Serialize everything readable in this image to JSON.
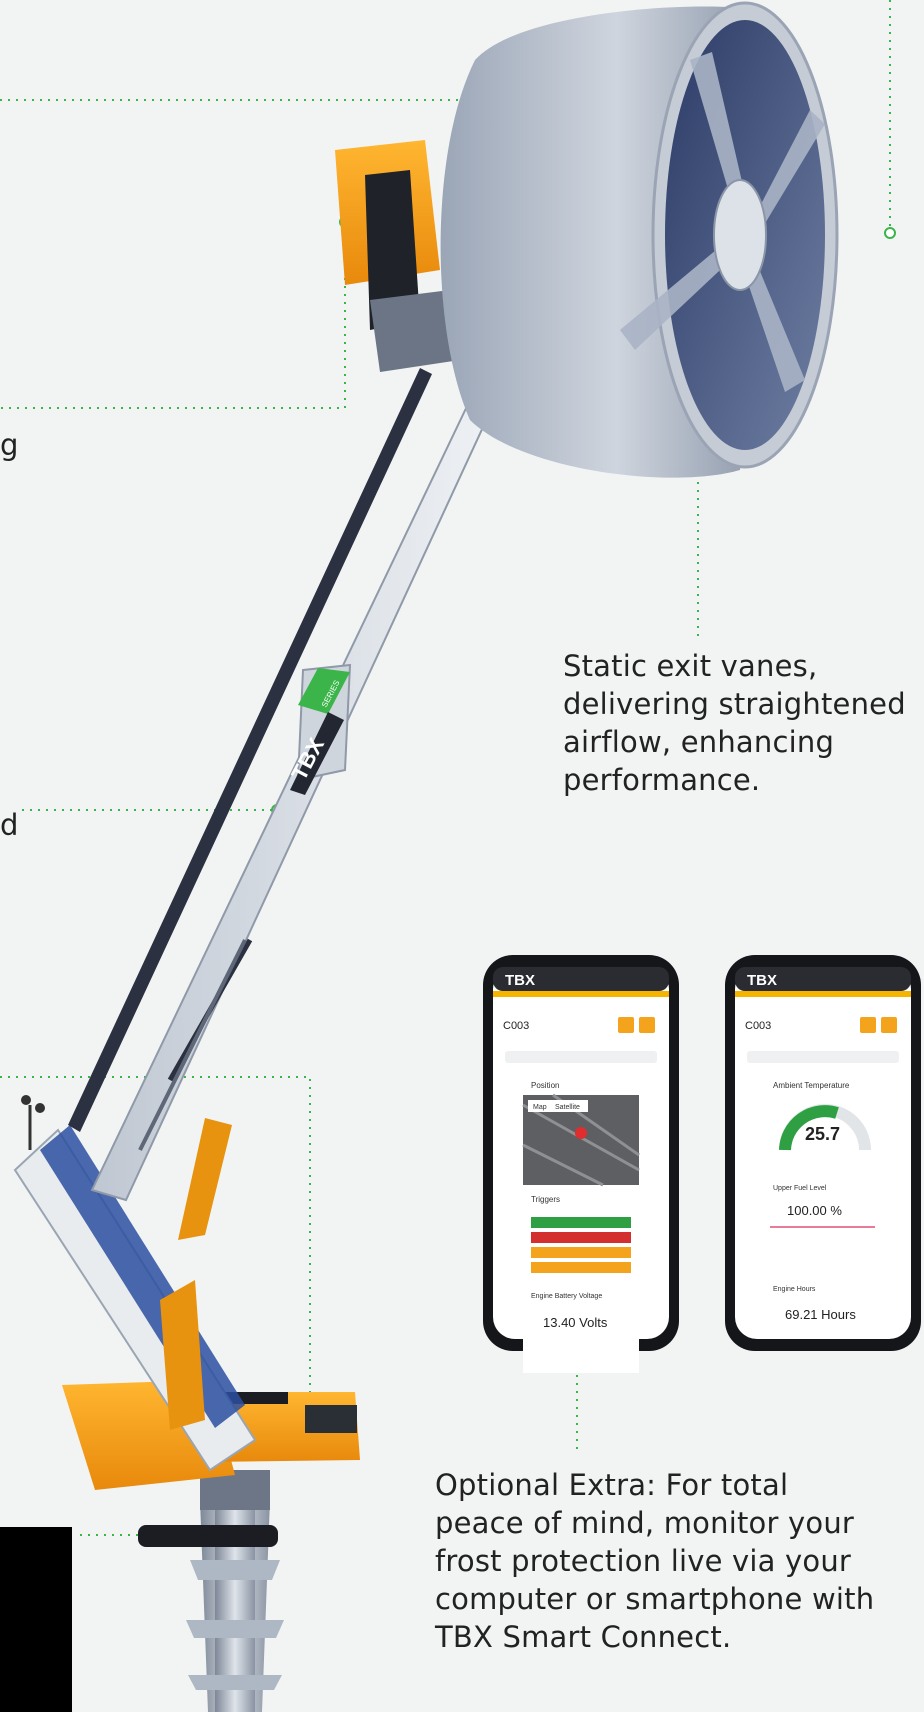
{
  "callouts": {
    "vanes_text": "Static exit vanes, delivering straightened airflow, enhancing performance.",
    "vanes_lines": [
      "Static exit vanes,",
      "delivering straightened",
      "airflow, enhancing",
      "performance."
    ],
    "smart_lines": [
      "Optional Extra: For total",
      "peace of mind, monitor your",
      "frost protection live via your",
      "computer or smartphone with",
      "TBX Smart Connect."
    ],
    "cut_left_1": "g",
    "cut_left_2": "d"
  },
  "machine": {
    "brand_mark": "TBX",
    "series_mark": "SERIES"
  },
  "phone_left": {
    "logo": "TBX",
    "site": "C003",
    "position_label": "Position",
    "map_tab_1": "Map",
    "map_tab_2": "Satellite",
    "triggers_label": "Triggers",
    "metric_label": "Engine Battery Voltage",
    "metric_value": "13.40 Volts"
  },
  "phone_right": {
    "logo": "TBX",
    "site": "C003",
    "gauge_label": "Ambient Temperature",
    "gauge_value": "25.7",
    "fuel_label": "Upper Fuel Level",
    "fuel_value": "100.00 %",
    "hours_label": "Engine Hours",
    "hours_value": "69.21 Hours"
  },
  "colors": {
    "accent_green": "#3bb54a",
    "orange": "#f4a41c",
    "steel": "#8d9aad",
    "background": "#f2f4f4"
  }
}
